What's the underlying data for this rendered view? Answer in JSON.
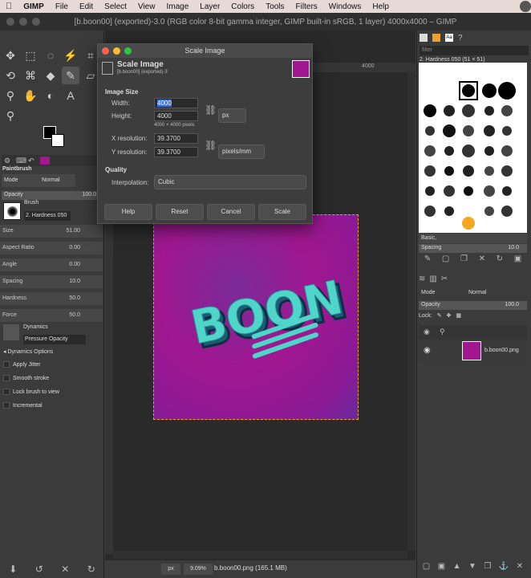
{
  "menubar": {
    "apple": "",
    "app_name": "GIMP",
    "items": [
      "File",
      "Edit",
      "Select",
      "View",
      "Image",
      "Layer",
      "Colors",
      "Tools",
      "Filters",
      "Windows",
      "Help"
    ]
  },
  "window": {
    "title": "[b.boon00] (exported)-3.0 (RGB color 8-bit gamma integer, GIMP built-in sRGB, 1 layer) 4000x4000 – GIMP"
  },
  "toolbox": {
    "dock_tab_label": "Paintbrush",
    "mode_label": "Mode",
    "mode_value": "Normal",
    "opacity_label": "Opacity",
    "opacity_value": "100.0",
    "brush_label": "Brush",
    "brush_name": "2. Hardness 050",
    "size_label": "Size",
    "size_value": "51.00",
    "aspect_label": "Aspect Ratio",
    "aspect_value": "0.00",
    "angle_label": "Angle",
    "angle_value": "0.00",
    "spacing_label": "Spacing",
    "spacing_value": "10.0",
    "hardness_label": "Hardness",
    "hardness_value": "50.0",
    "force_label": "Force",
    "force_value": "50.0",
    "dynamics_label": "Dynamics",
    "dynamics_value": "Pressure Opacity",
    "dynamics_options": "Dynamics Options",
    "apply_jitter": "Apply Jitter",
    "smooth_stroke": "Smooth stroke",
    "lock_brush": "Lock brush to view",
    "incremental": "Incremental"
  },
  "ruler": {
    "mark_4000": "4000"
  },
  "dialog": {
    "window_title": "Scale Image",
    "heading": "Scale Image",
    "subheading": "[b.boon00] (exported)-3",
    "image_size_label": "Image Size",
    "width_label": "Width:",
    "width_value": "4000",
    "height_label": "Height:",
    "height_value": "4000",
    "pixel_info": "4000 × 4000 pixels",
    "unit": "px",
    "xres_label": "X resolution:",
    "xres_value": "39.3700",
    "yres_label": "Y resolution:",
    "yres_value": "39.3700",
    "res_unit": "pixels/mm",
    "quality_label": "Quality",
    "interp_label": "Interpolation:",
    "interp_value": "Cubic",
    "buttons": {
      "help": "Help",
      "reset": "Reset",
      "cancel": "Cancel",
      "scale": "Scale"
    }
  },
  "statusbar": {
    "unit": "px",
    "zoom": "9.09%",
    "file_info": "b.boon00.png (165.1 MB)"
  },
  "brushes_panel": {
    "filter_placeholder": "filter",
    "selected_brush": "2. Hardness 050 (51 × 51)",
    "preset": "Basic,",
    "spacing_label": "Spacing",
    "spacing_value": "10.0"
  },
  "layers_panel": {
    "mode_label": "Mode",
    "mode_value": "Normal",
    "opacity_label": "Opacity",
    "opacity_value": "100.0",
    "lock_label": "Lock:",
    "layer_name": "b.boon00.png"
  },
  "artwork_text": "BOON",
  "colors": {
    "accent": "#a0178f",
    "selection_border": "#d4b000"
  }
}
